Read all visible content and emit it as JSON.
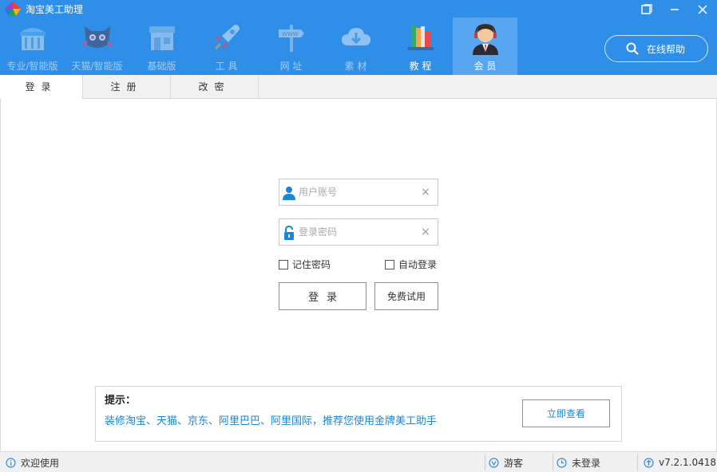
{
  "app": {
    "title": "淘宝美工助理"
  },
  "nav": {
    "items": [
      {
        "label": "专业/智能版",
        "icon": "store-icon"
      },
      {
        "label": "天猫/智能版",
        "icon": "tmall-cat-icon"
      },
      {
        "label": "基础版",
        "icon": "shop-building-icon"
      },
      {
        "label": "工 具",
        "icon": "rocket-icon"
      },
      {
        "label": "网 址",
        "icon": "www-signpost-icon"
      },
      {
        "label": "素 材",
        "icon": "cloud-download-icon"
      },
      {
        "label": "教 程",
        "icon": "books-icon"
      },
      {
        "label": "会 员",
        "icon": "member-avatar-icon"
      }
    ],
    "help_label": "在线帮助"
  },
  "tabs": [
    {
      "label": "登录"
    },
    {
      "label": "注册"
    },
    {
      "label": "改密"
    }
  ],
  "form": {
    "username_placeholder": "用户账号",
    "password_placeholder": "登录密码",
    "remember_label": "记住密码",
    "auto_login_label": "自动登录",
    "login_label": "登录",
    "trial_label": "免费试用",
    "clear_glyph": "×"
  },
  "tip": {
    "title": "提示：",
    "text": "装修淘宝、天猫、京东、阿里巴巴、阿里国际，推荐您使用金牌美工助手",
    "button_label": "立即查看"
  },
  "status": {
    "welcome": "欢迎使用",
    "user": "游客",
    "login_state": "未登录",
    "version": "v7.2.1.0418"
  },
  "colors": {
    "header": "#2f8ee8",
    "active_nav": "#58a6ef",
    "link": "#1a86d8"
  }
}
